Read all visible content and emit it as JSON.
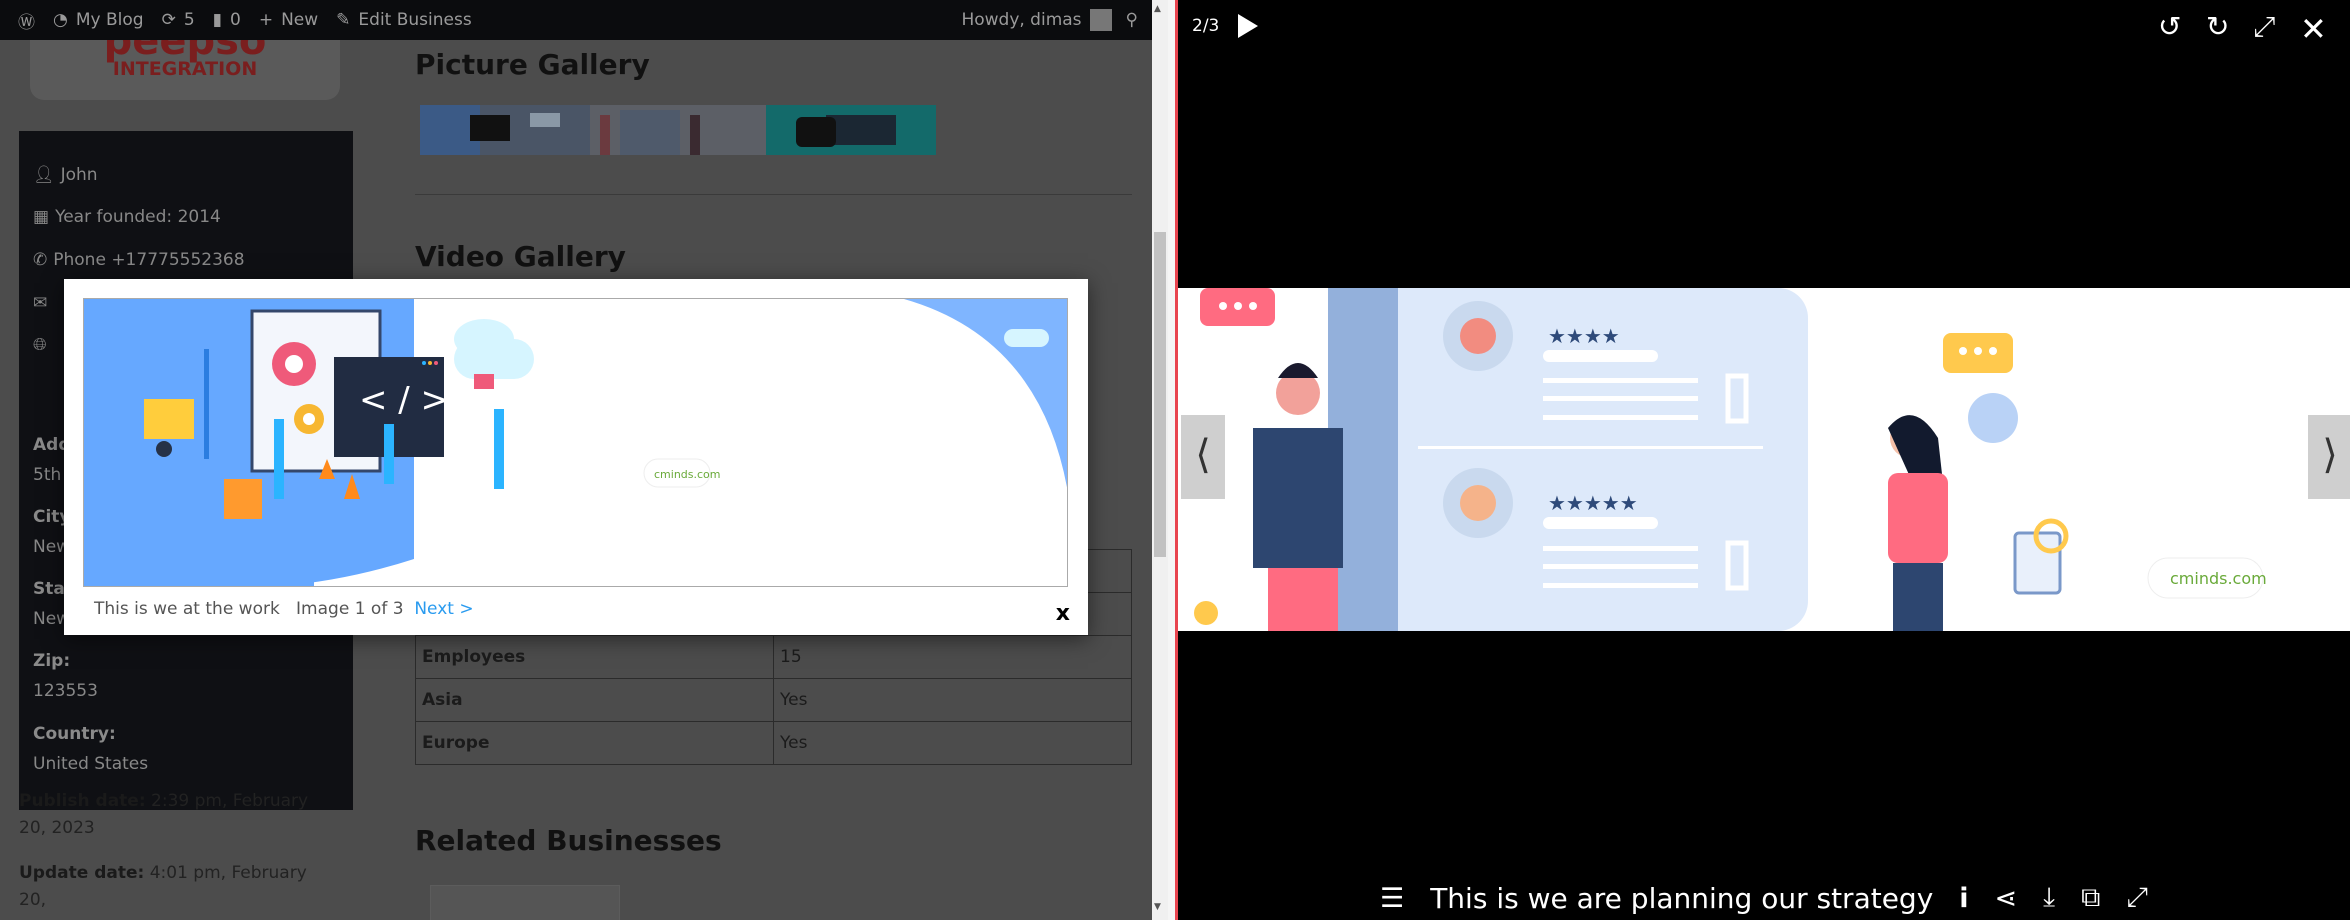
{
  "adminbar": {
    "site": "My Blog",
    "updates": "5",
    "comments": "0",
    "new": "New",
    "edit": "Edit Business",
    "howdy": "Howdy, dimas"
  },
  "logo": {
    "line1": "peepso",
    "line2": "INTEGRATION"
  },
  "sidebar": {
    "owner": "John",
    "year": "Year founded: 2014",
    "phone": "Phone +17775552368",
    "fields": [
      {
        "label": "Address:",
        "value": "5th"
      },
      {
        "label": "City:",
        "value": "New"
      },
      {
        "label": "State:",
        "value": "New"
      },
      {
        "label": "Zip:",
        "value": "123553"
      },
      {
        "label": "Country:",
        "value": "United States"
      }
    ]
  },
  "main": {
    "picture_gallery": "Picture Gallery",
    "video_gallery": "Video Gallery",
    "related": "Related Businesses",
    "table": [
      {
        "k": "Employees",
        "v": "15"
      },
      {
        "k": "Asia",
        "v": "Yes"
      },
      {
        "k": "Europe",
        "v": "Yes"
      }
    ]
  },
  "dates": {
    "publish_label": "Publish date:",
    "publish": "2:39 pm, February 20, 2023",
    "update_label": "Update date:",
    "update": "4:01 pm, February 20,"
  },
  "modal": {
    "caption": "This is we at the work",
    "counter": "Image 1 of 3",
    "next": "Next >",
    "close": "x",
    "watermark": "cminds.com"
  },
  "lightbox": {
    "counter": "2/3",
    "caption": "This is we are planning our strategy",
    "watermark": "cminds.com",
    "prev": "⟨",
    "next": "⟩"
  },
  "colors": {
    "accent_red": "#e8454f",
    "link": "#2a9bef"
  }
}
